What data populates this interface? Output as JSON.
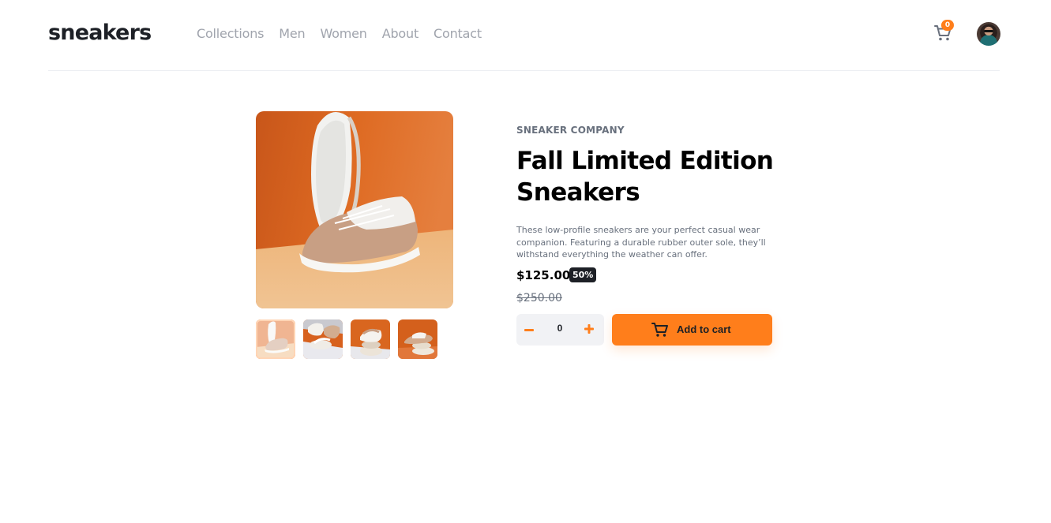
{
  "brand": {
    "logo_text": "sneakers",
    "accent": "#ff7e1b"
  },
  "nav": {
    "items": [
      {
        "label": "Collections"
      },
      {
        "label": "Men"
      },
      {
        "label": "Women"
      },
      {
        "label": "About"
      },
      {
        "label": "Contact"
      }
    ]
  },
  "header": {
    "cart_icon": "cart-icon",
    "cart_count": "0",
    "avatar_icon": "user-avatar"
  },
  "gallery": {
    "main_image": "product-image-1",
    "thumbnails": [
      {
        "name": "product-thumbnail-1",
        "selected": true
      },
      {
        "name": "product-thumbnail-2",
        "selected": false
      },
      {
        "name": "product-thumbnail-3",
        "selected": false
      },
      {
        "name": "product-thumbnail-4",
        "selected": false
      }
    ]
  },
  "product": {
    "company": "SNEAKER COMPANY",
    "title": "Fall Limited Edition Sneakers",
    "description": "These low-profile sneakers are your perfect casual wear companion. Featuring a durable rubber outer sole, they’ll withstand everything the weather can offer.",
    "price": "$125.00",
    "discount": "50%",
    "original_price": "$250.00"
  },
  "cart_controls": {
    "minus_icon": "minus-icon",
    "quantity": "0",
    "plus_icon": "plus-icon",
    "add_to_cart_label": "Add to cart"
  }
}
